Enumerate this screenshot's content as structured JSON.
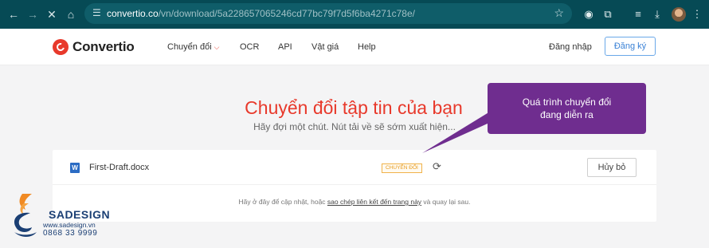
{
  "browser": {
    "url_host": "convertio.co",
    "url_path": "/vn/download/5a228657065246cd77bc79f7d5f6ba4271c78e/",
    "icons": [
      "back-icon",
      "forward-icon",
      "close-icon",
      "home-icon",
      "tune-icon",
      "star-icon",
      "extension-icon",
      "puzzle-icon",
      "media-icon",
      "download-icon",
      "avatar",
      "menu-icon"
    ]
  },
  "header": {
    "logo_text": "Convertio",
    "nav": [
      "Chuyển đổi",
      "OCR",
      "API",
      "Vật giá",
      "Help"
    ],
    "login_label": "Đăng nhập",
    "signup_label": "Đăng ký"
  },
  "main": {
    "title": "Chuyển đổi tập tin của bạn",
    "subtitle": "Hãy đợi một chút. Nút tải về sẽ sớm xuất hiện...",
    "file": {
      "name": "First-Draft.docx",
      "status": "CHUYỂN ĐỔI",
      "cancel_label": "Hủy bỏ"
    },
    "notice_prefix": "Hãy ở đây để cập nhật, hoặc ",
    "notice_link": "sao chép liên kết đến trang này",
    "notice_suffix": " và quay lại sau."
  },
  "callout": {
    "line1": "Quá trình chuyển đổi",
    "line2": "đang diễn ra"
  },
  "watermark": {
    "name": "SADESIGN",
    "site": "www.sadesign.vn",
    "phone": "0868 33 9999"
  },
  "colors": {
    "brand_red": "#e8392b",
    "callout_purple": "#6f2d8f",
    "chrome": "#064a55",
    "badge_orange": "#e79a1c"
  }
}
